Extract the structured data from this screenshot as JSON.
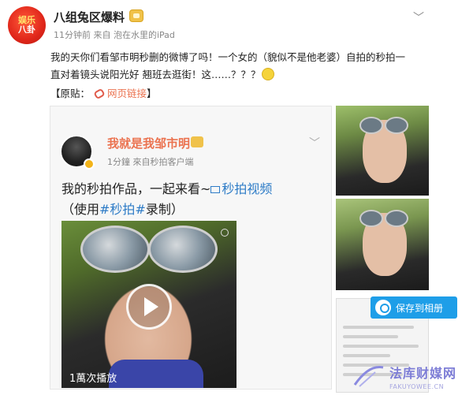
{
  "post": {
    "avatar_text_top": "娱乐",
    "avatar_text_bottom": "八卦",
    "username": "八组兔区爆料",
    "meta": "11分钟前 来自 泡在水里的iPad",
    "chevron": "﹀",
    "text": "我的天你们看邹市明秒删的微博了吗！一个女的（貌似不是他老婆）自拍的秒拍一直对着镜头说阳光好 翘班去逛街！这……？？？",
    "original_prefix": "【原贴：",
    "link_label": "网页链接",
    "original_suffix": "】"
  },
  "repost": {
    "name": "我就是我邹市明",
    "meta": "1分鐘   來自秒拍客户端",
    "chevron": "﹀",
    "line1": "我的秒拍作品，一起来看~",
    "video_link": "秒拍视频",
    "line2_prefix": "（使用",
    "hashtag": "#秒拍#",
    "line2_suffix": "录制）",
    "plays": "1萬次播放"
  },
  "overlay": {
    "save_label": "保存到相册"
  },
  "watermark": {
    "title": "法库财媒网",
    "subtitle": "FAKUYOWEE.CN"
  },
  "colors": {
    "link": "#eb7350",
    "repost_name": "#eb7350",
    "video_link": "#2e7cc7",
    "save_button": "#1e9ee8"
  }
}
